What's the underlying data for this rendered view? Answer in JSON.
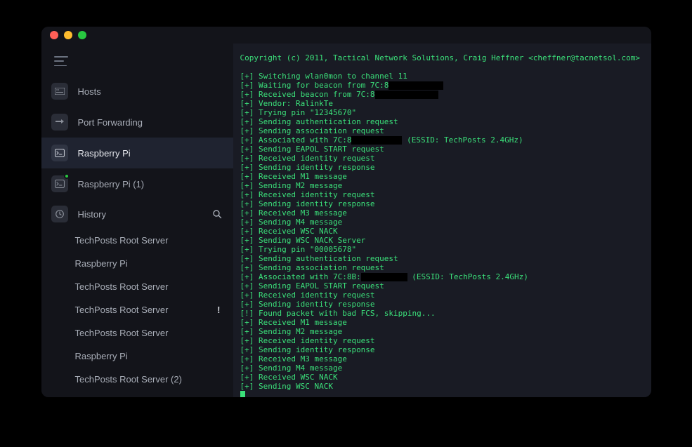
{
  "sidebar": {
    "items": [
      {
        "label": "Hosts"
      },
      {
        "label": "Port Forwarding"
      },
      {
        "label": "Raspberry Pi"
      },
      {
        "label": "Raspberry Pi (1)"
      }
    ],
    "history_label": "History",
    "history": [
      {
        "label": "TechPosts Root Server"
      },
      {
        "label": "Raspberry Pi"
      },
      {
        "label": "TechPosts Root Server"
      },
      {
        "label": "TechPosts Root Server",
        "alert": true
      },
      {
        "label": "TechPosts Root Server"
      },
      {
        "label": "Raspberry Pi"
      },
      {
        "label": "TechPosts Root Server (2)"
      }
    ]
  },
  "terminal": {
    "copyright": "Copyright (c) 2011, Tactical Network Solutions, Craig Heffner <cheffner@tacnetsol.com>",
    "lines": [
      {
        "p": "[+]",
        "t": "Switching wlan0mon to channel 11"
      },
      {
        "p": "[+]",
        "t": "Waiting for beacon from 7C:8",
        "redact": 13
      },
      {
        "p": "[+]",
        "t": "Received beacon from 7C:8",
        "redact": 15
      },
      {
        "p": "[+]",
        "t": "Vendor: RalinkTe"
      },
      {
        "p": "[+]",
        "t": "Trying pin \"12345670\""
      },
      {
        "p": "[+]",
        "t": "Sending authentication request"
      },
      {
        "p": "[+]",
        "t": "Sending association request"
      },
      {
        "p": "[+]",
        "t": "Associated with 7C:8",
        "redact": 12,
        "after": " (ESSID: TechPosts 2.4GHz)"
      },
      {
        "p": "[+]",
        "t": "Sending EAPOL START request"
      },
      {
        "p": "[+]",
        "t": "Received identity request"
      },
      {
        "p": "[+]",
        "t": "Sending identity response"
      },
      {
        "p": "[+]",
        "t": "Received M1 message"
      },
      {
        "p": "[+]",
        "t": "Sending M2 message"
      },
      {
        "p": "[+]",
        "t": "Received identity request"
      },
      {
        "p": "[+]",
        "t": "Sending identity response"
      },
      {
        "p": "[+]",
        "t": "Received M3 message"
      },
      {
        "p": "[+]",
        "t": "Sending M4 message"
      },
      {
        "p": "[+]",
        "t": "Received WSC NACK"
      },
      {
        "p": "[+]",
        "t": "Sending WSC NACK Server"
      },
      {
        "p": "[+]",
        "t": "Trying pin \"00005678\""
      },
      {
        "p": "[+]",
        "t": "Sending authentication request"
      },
      {
        "p": "[+]",
        "t": "Sending association request"
      },
      {
        "p": "[+]",
        "t": "Associated with 7C:8B:",
        "redact": 11,
        "after": " (ESSID: TechPosts 2.4GHz)"
      },
      {
        "p": "[+]",
        "t": "Sending EAPOL START request"
      },
      {
        "p": "[+]",
        "t": "Received identity request"
      },
      {
        "p": "[+]",
        "t": "Sending identity response"
      },
      {
        "p": "[!]",
        "t": "Found packet with bad FCS, skipping..."
      },
      {
        "p": "[+]",
        "t": "Received M1 message"
      },
      {
        "p": "[+]",
        "t": "Sending M2 message"
      },
      {
        "p": "[+]",
        "t": "Received identity request"
      },
      {
        "p": "[+]",
        "t": "Sending identity response"
      },
      {
        "p": "[+]",
        "t": "Received M3 message"
      },
      {
        "p": "[+]",
        "t": "Sending M4 message"
      },
      {
        "p": "[+]",
        "t": "Received WSC NACK"
      },
      {
        "p": "[+]",
        "t": "Sending WSC NACK"
      }
    ]
  }
}
